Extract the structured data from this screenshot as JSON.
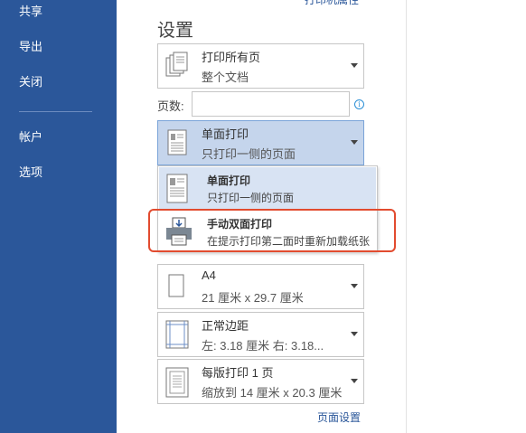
{
  "nav": {
    "items": [
      {
        "label": "共享"
      },
      {
        "label": "导出"
      },
      {
        "label": "关闭"
      },
      {
        "label": "帐户"
      },
      {
        "label": "选项"
      }
    ]
  },
  "settings": {
    "title": "设置",
    "top_link": "打印机属性",
    "print_range": {
      "title": "打印所有页",
      "subtitle": "整个文档"
    },
    "pages": {
      "label": "页数:",
      "value": "",
      "info_glyph": "i"
    },
    "sides": {
      "title": "单面打印",
      "subtitle": "只打印一侧的页面"
    },
    "sides_menu": [
      {
        "title": "单面打印",
        "subtitle": "只打印一侧的页面",
        "selected": true
      },
      {
        "title": "手动双面打印",
        "subtitle": "在提示打印第二面时重新加载纸张",
        "selected": false
      }
    ],
    "paper": {
      "title": "A4",
      "subtitle": "21 厘米 x 29.7 厘米"
    },
    "margins": {
      "title": "正常边距",
      "subtitle": "左: 3.18 厘米    右: 3.18..."
    },
    "per_sheet": {
      "title": "每版打印 1 页",
      "subtitle": "缩放到 14 厘米 x 20.3 厘米"
    },
    "page_setup_link": "页面设置"
  },
  "colors": {
    "nav_bg": "#2b579a",
    "highlight": "#e24b2f",
    "open_dropdown": "#c5d5ec"
  }
}
